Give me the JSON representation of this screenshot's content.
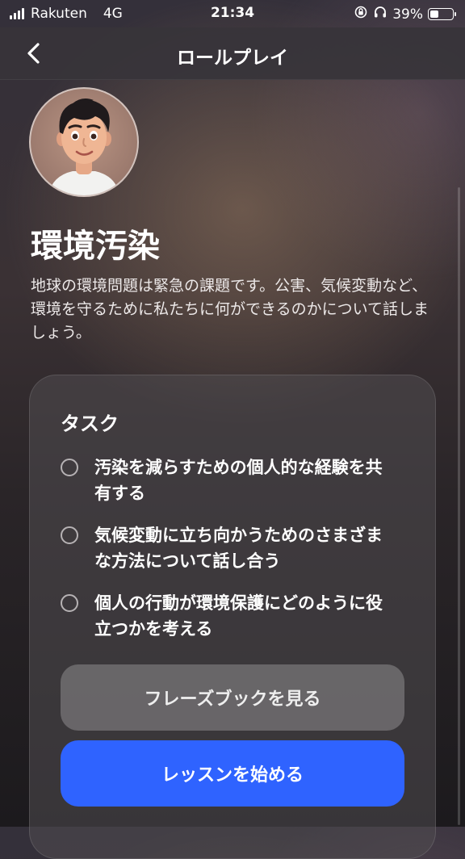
{
  "status_bar": {
    "carrier": "Rakuten",
    "network": "4G",
    "time": "21:34",
    "battery_percent": "39%",
    "battery_level": 0.39
  },
  "nav": {
    "title": "ロールプレイ"
  },
  "topic": {
    "title": "環境汚染",
    "description": "地球の環境問題は緊急の課題です。公害、気候変動など、環境を守るために私たちに何ができるのかについて話しましょう。"
  },
  "tasks": {
    "heading": "タスク",
    "items": [
      {
        "label": "汚染を減らすための個人的な経験を共有する"
      },
      {
        "label": "気候変動に立ち向かうためのさまざまな方法について話し合う"
      },
      {
        "label": "個人の行動が環境保護にどのように役立つかを考える"
      }
    ]
  },
  "buttons": {
    "phrasebook": "フレーズブックを見る",
    "start": "レッスンを始める"
  },
  "colors": {
    "accent": "#2f63ff"
  }
}
